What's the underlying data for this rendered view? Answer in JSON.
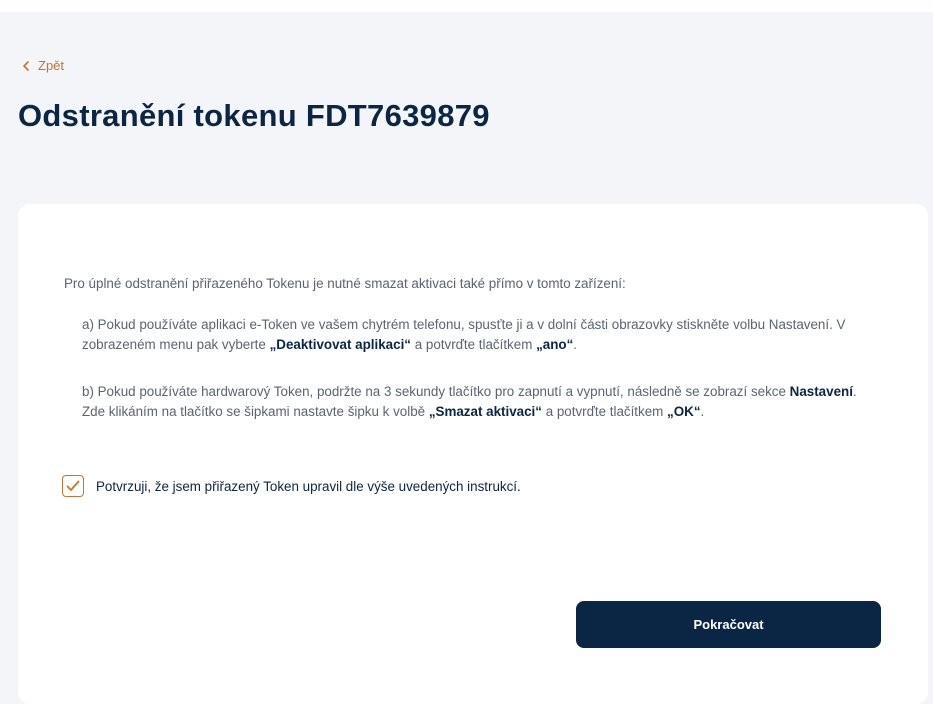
{
  "header": {
    "back_label": "Zpět",
    "title": "Odstranění tokenu FDT7639879"
  },
  "card": {
    "intro": "Pro úplné odstranění přiřazeného Tokenu je nutné smazat aktivaci také přímo v tomto zařízení:",
    "instruction_a": {
      "part1": "a) Pokud používáte aplikaci e-Token ve vašem chytrém telefonu, spusťte ji a v dolní části obrazovky stiskněte volbu Nastavení. V zobrazeném menu pak vyberte ",
      "bold1": "„Deaktivovat aplikaci“",
      "part2": " a potvrďte tlačítkem ",
      "bold2": "„ano“",
      "part3": "."
    },
    "instruction_b": {
      "part1": "b) Pokud používáte hardwarový Token, podržte na 3 sekundy tlačítko pro zapnutí a vypnutí, následně se zobrazí sekce ",
      "bold1": "Nastavení",
      "part2": ". Zde klikáním na tlačítko se šipkami nastavte šipku k volbě ",
      "bold2": "„Smazat aktivaci“",
      "part3": " a potvrďte tlačítkem ",
      "bold3": "„OK“",
      "part4": "."
    },
    "confirm_label": "Potvrzuji, že jsem přiřazený Token upravil dle výše uvedených instrukcí.",
    "confirm_checked": true,
    "continue_label": "Pokračovat"
  },
  "icons": {
    "back": "chevron-left-icon",
    "check": "checkmark-icon"
  },
  "colors": {
    "accent": "#c6752e",
    "primary": "#0b2545",
    "text_muted": "#5a6472",
    "background": "#f4f5f8"
  }
}
